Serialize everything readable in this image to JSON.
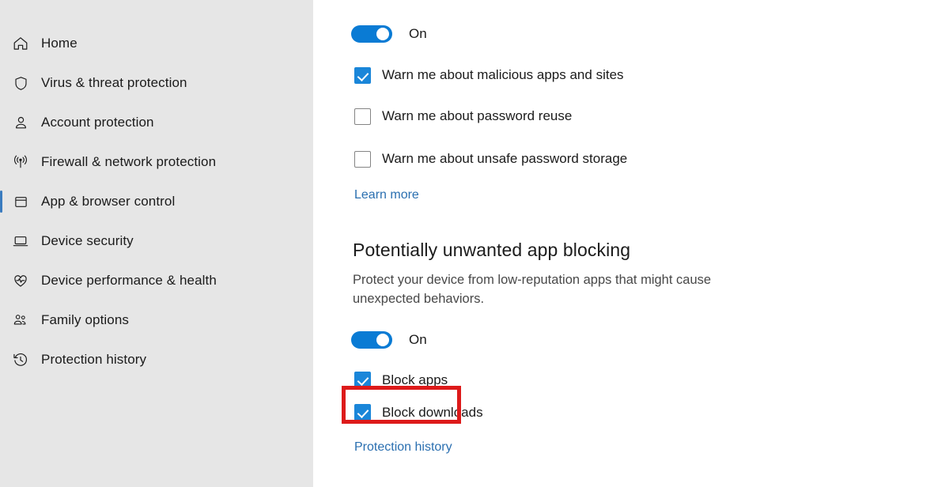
{
  "sidebar": {
    "items": [
      {
        "label": "Home",
        "icon": "home-icon",
        "selected": false
      },
      {
        "label": "Virus & threat protection",
        "icon": "shield-icon",
        "selected": false
      },
      {
        "label": "Account protection",
        "icon": "person-icon",
        "selected": false
      },
      {
        "label": "Firewall & network protection",
        "icon": "wifi-signal-icon",
        "selected": false
      },
      {
        "label": "App & browser control",
        "icon": "window-icon",
        "selected": true
      },
      {
        "label": "Device security",
        "icon": "laptop-icon",
        "selected": false
      },
      {
        "label": "Device performance & health",
        "icon": "heart-pulse-icon",
        "selected": false
      },
      {
        "label": "Family options",
        "icon": "people-group-icon",
        "selected": false
      },
      {
        "label": "Protection history",
        "icon": "clock-history-icon",
        "selected": false
      }
    ],
    "background_color": "#e6e6e6",
    "selection_accent_color": "#3a7bbf"
  },
  "main": {
    "reputation_section": {
      "toggle": {
        "state_label": "On",
        "on": true
      },
      "checkboxes": [
        {
          "label": "Warn me about malicious apps and sites",
          "checked": true
        },
        {
          "label": "Warn me about password reuse",
          "checked": false
        },
        {
          "label": "Warn me about unsafe password storage",
          "checked": false
        }
      ],
      "link_label": "Learn more"
    },
    "pua_section": {
      "title": "Potentially unwanted app blocking",
      "description": "Protect your device from low-reputation apps that might cause unexpected behaviors.",
      "toggle": {
        "state_label": "On",
        "on": true
      },
      "checkboxes": [
        {
          "label": "Block apps",
          "checked": true,
          "highlighted": true
        },
        {
          "label": "Block downloads",
          "checked": true,
          "highlighted": false
        }
      ],
      "link_label": "Protection history"
    }
  },
  "colors": {
    "accent_blue": "#0a7bd4",
    "checkbox_blue": "#1a86d9",
    "link_blue": "#2a6fb0",
    "highlight_red": "#dd1a1a",
    "text_primary": "#1b1b1b",
    "text_secondary": "#484848"
  }
}
